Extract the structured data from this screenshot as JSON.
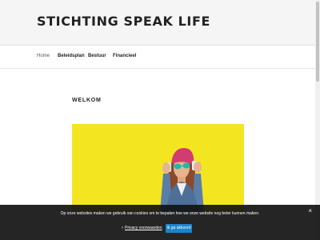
{
  "site": {
    "title": "STICHTING SPEAK LIFE"
  },
  "nav": {
    "items": [
      {
        "label": "Home"
      },
      {
        "label": "Beleidsplan"
      },
      {
        "label": "Bestuur"
      },
      {
        "label": "Financieel"
      }
    ]
  },
  "main": {
    "heading": "WELKOM"
  },
  "cookie": {
    "message": "Op onze websites maken we gebruik van cookies om te bepalen hoe we onze website nog beter kunnen maken.",
    "close_label": "×",
    "policy_link": "Privacy voorwaarden",
    "accept_label": "Ik ga akkoord"
  }
}
